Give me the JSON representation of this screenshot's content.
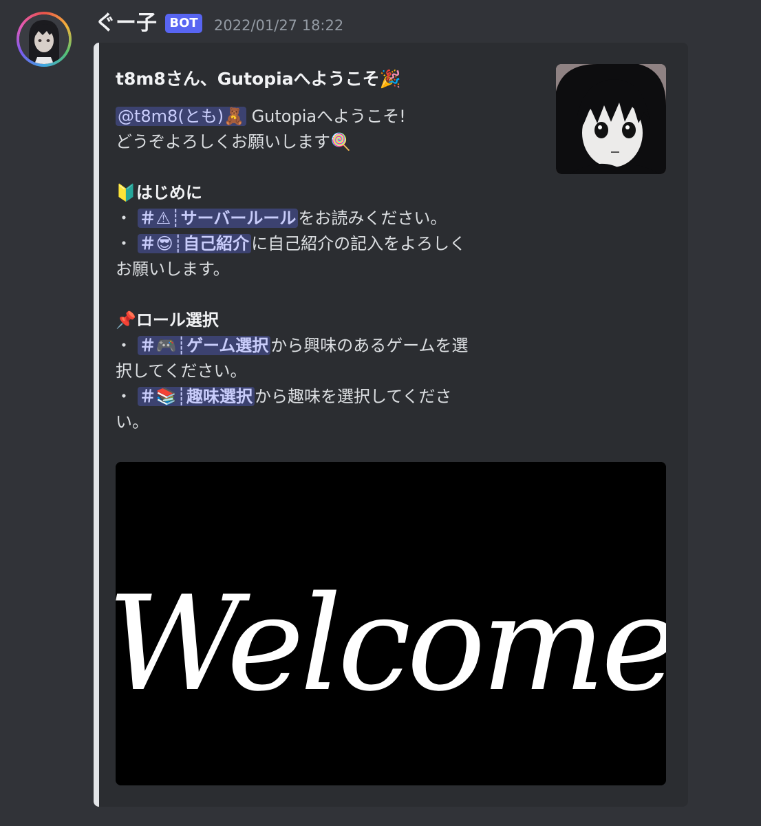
{
  "message": {
    "username": "ぐー子",
    "badge": "BOT",
    "timestamp": "2022/01/27 18:22"
  },
  "embed": {
    "title": "t8m8さん、Gutopiaへようこそ🎉",
    "mention": "@t8m8(とも)🧸",
    "line1_rest": " Gutopiaへようこそ!",
    "line2": "どうぞよろしくお願いします🍭",
    "section1_heading": "🔰はじめに",
    "bullet": "・ ",
    "ch_rules": "＃⚠┊サーバールール",
    "ch_rules_after": "をお読みください。",
    "ch_intro": "＃😎┊自己紹介",
    "ch_intro_after": "に自己紹介の記入をよろしく",
    "ch_intro_after2": "お願いします。",
    "section2_heading": "📌ロール選択",
    "ch_game": "＃🎮┊ゲーム選択",
    "ch_game_after": "から興味のあるゲームを選",
    "ch_game_after2": "択してください。",
    "ch_hobby": "＃📚┊趣味選択",
    "ch_hobby_after": "から趣味を選択してくださ",
    "ch_hobby_after2": "い。",
    "image_text": "Welcome"
  },
  "colors": {
    "background": "#313338",
    "embed_bg": "#2b2d31",
    "embed_border": "#e3e5e8",
    "badge": "#5865f2",
    "mention_bg": "#3c4270",
    "mention_text": "#c9cdfb"
  }
}
